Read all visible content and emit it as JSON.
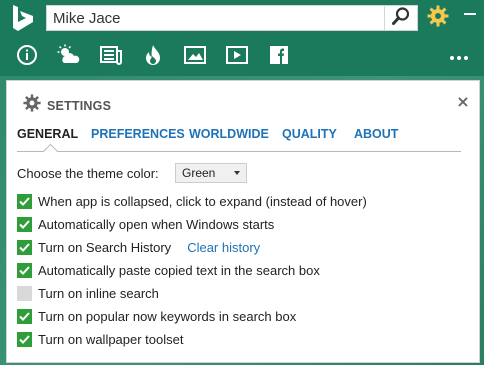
{
  "search": {
    "value": "Mike Jace"
  },
  "colors": {
    "brand": "#1b7a5c",
    "accent_gear": "#f2c94c",
    "link": "#1e73b8",
    "check_on": "#2f9e3a",
    "check_off": "#d9d9d9"
  },
  "toolbar_icons": [
    "info-icon",
    "weather-icon",
    "news-icon",
    "trending-icon",
    "image-icon",
    "video-icon",
    "facebook-icon",
    "more-icon"
  ],
  "settings": {
    "title": "SETTINGS",
    "tabs": [
      {
        "label": "GENERAL",
        "active": true
      },
      {
        "label": "PREFERENCES",
        "active": false
      },
      {
        "label": "WORLDWIDE",
        "active": false
      },
      {
        "label": "QUALITY",
        "active": false
      },
      {
        "label": "ABOUT",
        "active": false
      }
    ],
    "theme": {
      "label": "Choose the theme color:",
      "selected": "Green"
    },
    "options": [
      {
        "label": "When app is collapsed, click to expand (instead of hover)",
        "checked": true
      },
      {
        "label": "Automatically open when Windows starts",
        "checked": true
      },
      {
        "label": "Turn on Search History",
        "checked": true,
        "link": "Clear history"
      },
      {
        "label": "Automatically paste copied text in the search box",
        "checked": true
      },
      {
        "label": "Turn on inline search",
        "checked": false
      },
      {
        "label": "Turn on popular now keywords in search box",
        "checked": true
      },
      {
        "label": "Turn on wallpaper toolset",
        "checked": true
      }
    ]
  }
}
